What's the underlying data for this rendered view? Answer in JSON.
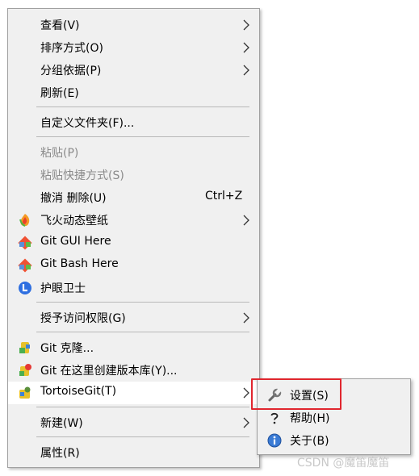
{
  "context_menu": {
    "items": [
      {
        "label": "查看(V)",
        "has_submenu": true
      },
      {
        "label": "排序方式(O)",
        "has_submenu": true
      },
      {
        "label": "分组依据(P)",
        "has_submenu": true
      },
      {
        "label": "刷新(E)"
      },
      {
        "label": "自定义文件夹(F)..."
      },
      {
        "label": "粘贴(P)",
        "disabled": true
      },
      {
        "label": "粘贴快捷方式(S)",
        "disabled": true
      },
      {
        "label": "撤消 删除(U)",
        "shortcut": "Ctrl+Z"
      },
      {
        "label": "飞火动态壁纸",
        "icon": "feihuo-wallpaper-icon",
        "has_submenu": true
      },
      {
        "label": "Git GUI Here",
        "icon": "git-gui-icon"
      },
      {
        "label": "Git Bash Here",
        "icon": "git-bash-icon"
      },
      {
        "label": "护眼卫士",
        "icon": "eye-guard-icon"
      },
      {
        "label": "授予访问权限(G)",
        "has_submenu": true
      },
      {
        "label": "Git 克隆...",
        "icon": "git-clone-icon"
      },
      {
        "label": "Git 在这里创建版本库(Y)...",
        "icon": "git-create-repo-icon"
      },
      {
        "label": "TortoiseGit(T)",
        "icon": "tortoisegit-icon",
        "has_submenu": true
      },
      {
        "label": "新建(W)",
        "has_submenu": true
      },
      {
        "label": "属性(R)"
      }
    ]
  },
  "tortoisegit_submenu": {
    "items": [
      {
        "label": "设置(S)",
        "icon": "wrench-icon"
      },
      {
        "label": "帮助(H)",
        "icon": "help-icon"
      },
      {
        "label": "关于(B)",
        "icon": "info-icon"
      }
    ]
  },
  "watermark": "CSDN @魔笛魔笛",
  "colors": {
    "menu_bg": "#f0f0f0",
    "border": "#a0a0a0",
    "disabled_text": "#8a8a8a",
    "highlight_box": "#e0262e"
  }
}
